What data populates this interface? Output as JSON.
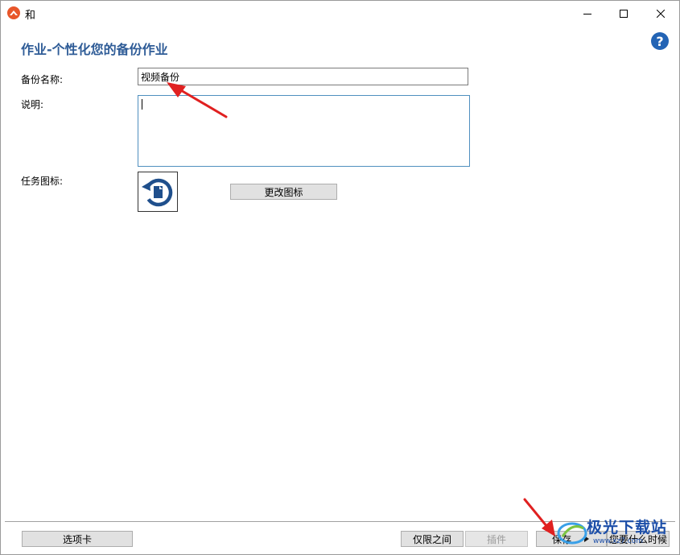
{
  "window": {
    "title": "和",
    "controls": {
      "minimize": "minimize-icon",
      "maximize": "maximize-icon",
      "close": "close-icon"
    }
  },
  "page": {
    "title": "作业-个性化您的备份作业",
    "help": "?"
  },
  "form": {
    "name_label": "备份名称:",
    "name_value": "视频备份",
    "description_label": "说明:",
    "description_value": "",
    "icon_label": "任务图标:",
    "change_icon_button": "更改图标"
  },
  "footer": {
    "tabs_button": "选项卡",
    "only_between_button": "仅限之间",
    "plugin_button": "插件",
    "save_button": "保存",
    "when_button": "您要什么时候"
  },
  "watermark": {
    "text": "极光下载站",
    "url": "www.xz7.com"
  },
  "colors": {
    "title_blue": "#2f5c97",
    "help_blue": "#2364b5",
    "app_icon": "#e8562a",
    "annotation_red": "#e02020"
  }
}
